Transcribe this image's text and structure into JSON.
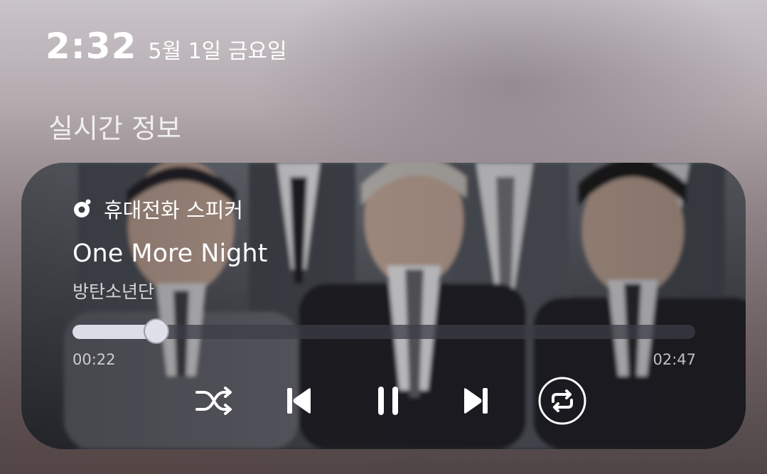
{
  "status": {
    "time": "2:32",
    "date": "5월 1일 금요일"
  },
  "section": {
    "title": "실시간 정보"
  },
  "player": {
    "output_device": "휴대전화 스피커",
    "track_title": "One More Night",
    "artist": "방탄소년단",
    "elapsed": "00:22",
    "duration": "02:47",
    "progress_fraction": 0.135,
    "icons": {
      "device": "speaker-icon",
      "shuffle": "shuffle-icon",
      "previous": "skip-previous-icon",
      "play_pause": "pause-icon",
      "next": "skip-next-icon",
      "repeat": "repeat-icon"
    }
  }
}
